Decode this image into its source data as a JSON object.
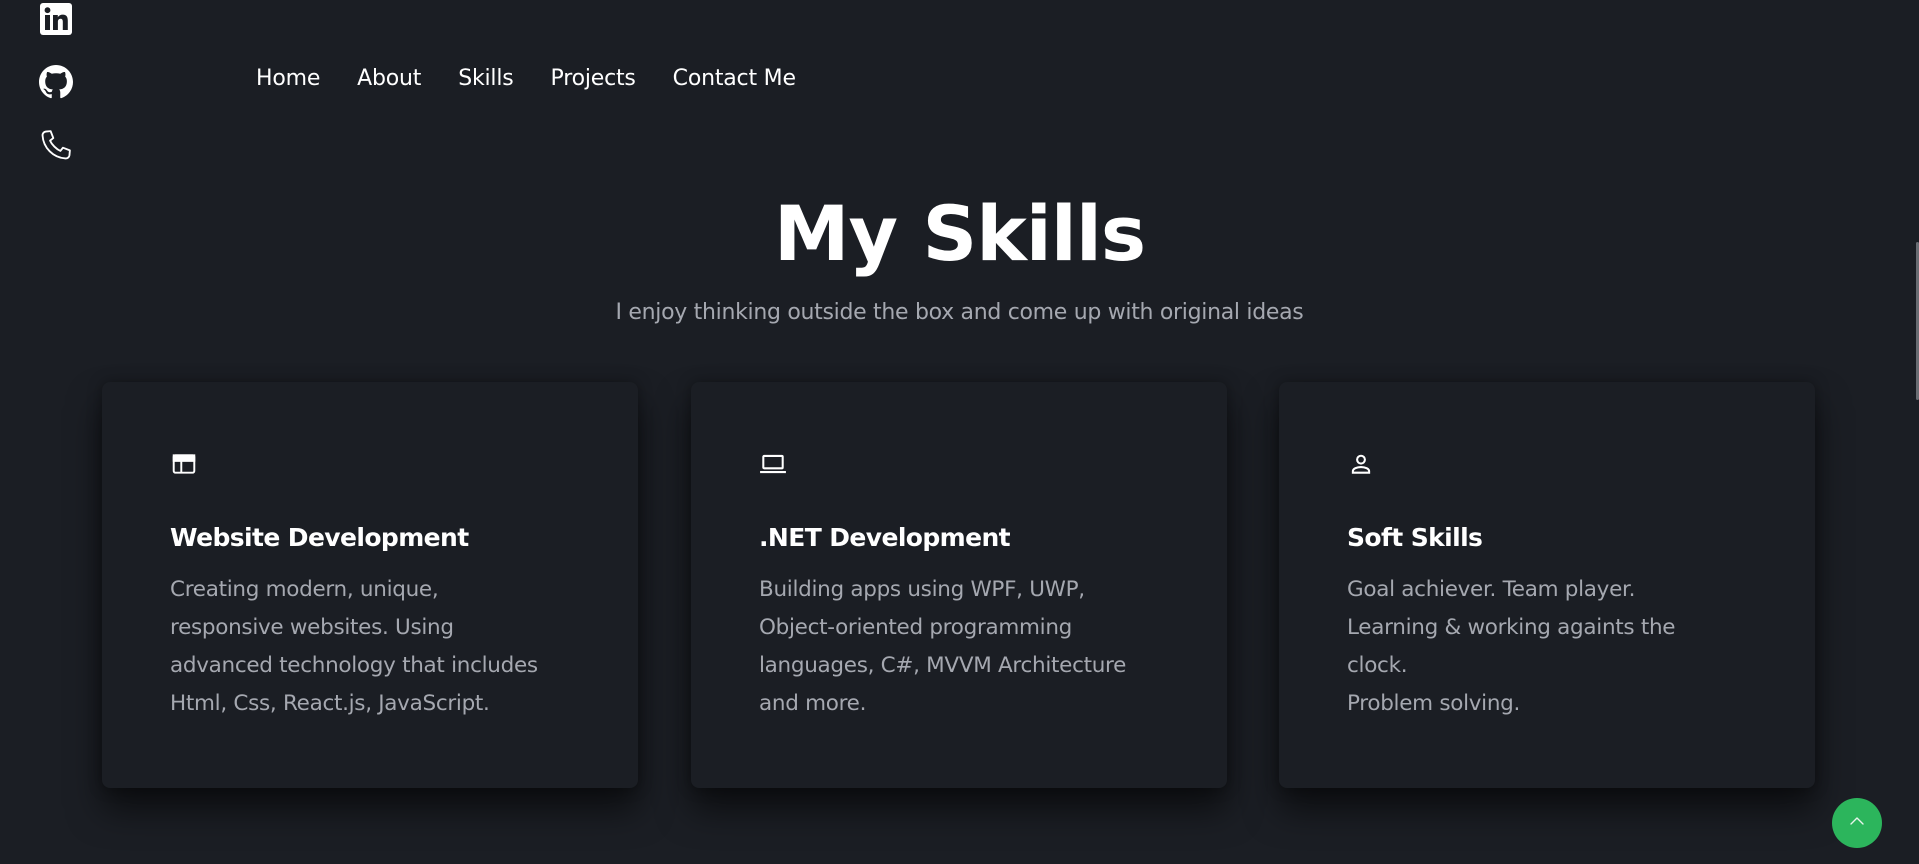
{
  "social": {
    "items": [
      {
        "icon": "linkedin-icon"
      },
      {
        "icon": "github-icon"
      },
      {
        "icon": "phone-icon"
      }
    ]
  },
  "nav": {
    "items": [
      "Home",
      "About",
      "Skills",
      "Projects",
      "Contact Me"
    ]
  },
  "skills": {
    "title": "My Skills",
    "subtitle": "I enjoy thinking outside the box and come up with original ideas",
    "cards": [
      {
        "icon": "browser-window-icon",
        "title": "Website Development",
        "lines": [
          "Creating modern, unique,",
          "responsive websites. Using",
          "advanced technology that includes",
          "Html, Css, React.js, JavaScript."
        ]
      },
      {
        "icon": "laptop-icon",
        "title": ".NET Development",
        "lines": [
          "Building apps using WPF, UWP,",
          "Object-oriented programming",
          "languages, C#, MVVM Architecture",
          "and more."
        ]
      },
      {
        "icon": "person-icon",
        "title": "Soft Skills",
        "lines": [
          "Goal achiever. Team player.",
          "Learning & working againts the",
          "clock.",
          "Problem solving."
        ]
      }
    ]
  },
  "back_to_top": {
    "icon": "chevron-up-icon"
  },
  "colors": {
    "background": "#1b1e24",
    "text": "#ffffff",
    "muted": "#a5a8b0",
    "accent": "#2cb55c"
  }
}
